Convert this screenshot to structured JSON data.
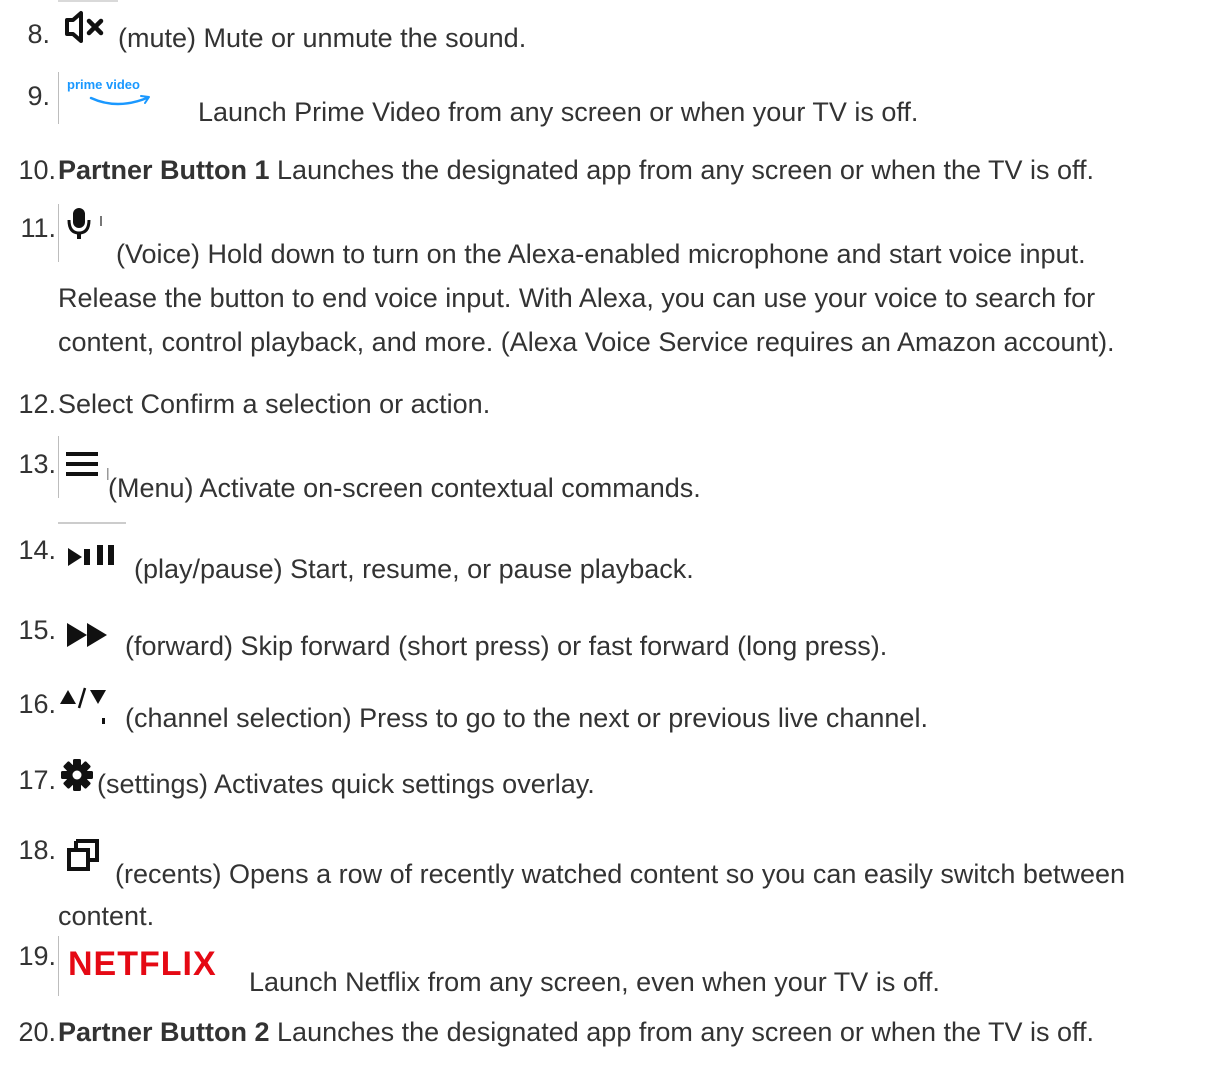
{
  "items": [
    {
      "num": "8.",
      "text": "(mute) Mute or unmute the sound.",
      "icon": "mute-icon"
    },
    {
      "num": "9.",
      "text": "Launch Prime Video from any screen or when your TV is off.",
      "icon": "prime-video-logo",
      "logo_text": "prime video"
    },
    {
      "num": "10.",
      "bold": "Partner Button 1",
      "text": " Launches the designated app from any screen or when the TV is off."
    },
    {
      "num": "11.",
      "text": "(Voice) Hold down to turn on the Alexa-enabled microphone and start voice input.",
      "text2": "Release the button to end voice input. With Alexa, you can use your voice to search for",
      "text3": "content, control playback, and more. (Alexa Voice Service requires an Amazon account).",
      "icon": "microphone-icon"
    },
    {
      "num": "12.",
      "text": "Select Confirm a selection or action."
    },
    {
      "num": "13.",
      "text": "(Menu) Activate on-screen contextual commands.",
      "icon": "menu-icon"
    },
    {
      "num": "14.",
      "text": "(play/pause) Start, resume, or pause playback.",
      "icon": "play-pause-icon"
    },
    {
      "num": "15.",
      "text": "(forward) Skip forward (short press) or fast forward (long press).",
      "icon": "fast-forward-icon"
    },
    {
      "num": "16.",
      "text": "(channel selection) Press to go to the next or previous live channel.",
      "icon": "channel-up-down-icon"
    },
    {
      "num": "17.",
      "text": "(settings) Activates quick settings overlay.",
      "icon": "gear-icon"
    },
    {
      "num": "18.",
      "text": "(recents) Opens a row of recently watched content so you can easily switch between",
      "text2": "content.",
      "icon": "recents-icon"
    },
    {
      "num": "19.",
      "text": "Launch Netflix from any screen, even when your TV is off.",
      "icon": "netflix-logo",
      "logo_text": "NETFLIX"
    },
    {
      "num": "20.",
      "bold": "Partner Button 2",
      "text": " Launches the designated app from any screen or when the TV is off."
    }
  ]
}
